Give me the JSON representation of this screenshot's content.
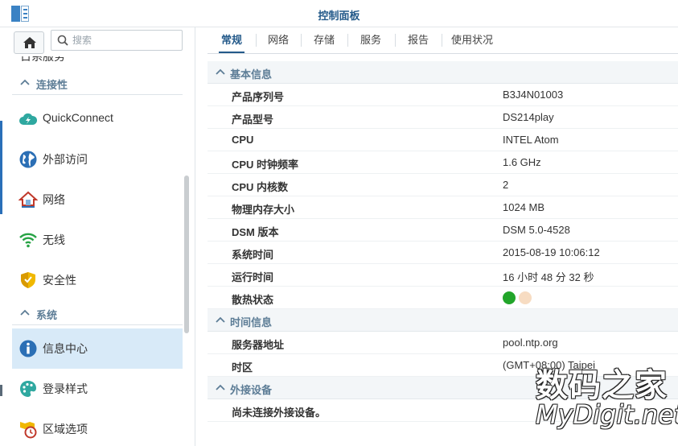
{
  "window": {
    "title": "控制面板"
  },
  "sidebar": {
    "search_placeholder": "搜索",
    "cut_item": "日系服务",
    "sections": [
      {
        "label": "连接性"
      },
      {
        "label": "系统"
      }
    ],
    "items": [
      {
        "label": "QuickConnect",
        "icon": "quickconnect-cloud-icon"
      },
      {
        "label": "外部访问",
        "icon": "globe-icon"
      },
      {
        "label": "网络",
        "icon": "house-network-icon"
      },
      {
        "label": "无线",
        "icon": "wifi-icon"
      },
      {
        "label": "安全性",
        "icon": "shield-icon"
      },
      {
        "label": "信息中心",
        "icon": "info-icon",
        "active": true
      },
      {
        "label": "登录样式",
        "icon": "palette-icon"
      },
      {
        "label": "区域选项",
        "icon": "clock-map-icon"
      }
    ]
  },
  "tabs": [
    {
      "label": "常规",
      "active": true
    },
    {
      "label": "网络"
    },
    {
      "label": "存储"
    },
    {
      "label": "服务"
    },
    {
      "label": "报告"
    },
    {
      "label": "使用状况"
    }
  ],
  "groups": {
    "basic": {
      "title": "基本信息",
      "rows": [
        {
          "key": "产品序列号",
          "value": "B3J4N01003"
        },
        {
          "key": "产品型号",
          "value": "DS214play"
        },
        {
          "key": "CPU",
          "value": "INTEL Atom"
        },
        {
          "key": "CPU 时钟频率",
          "value": "1.6 GHz"
        },
        {
          "key": "CPU 内核数",
          "value": "2"
        },
        {
          "key": "物理内存大小",
          "value": "1024 MB"
        },
        {
          "key": "DSM 版本",
          "value": "DSM 5.0-4528"
        },
        {
          "key": "系统时间",
          "value": "2015-08-19 10:06:12"
        },
        {
          "key": "运行时间",
          "value": "16 小时 48 分 32 秒"
        },
        {
          "key": "散热状态"
        }
      ]
    },
    "time": {
      "title": "时间信息",
      "rows": [
        {
          "key": "服务器地址",
          "value": "pool.ntp.org"
        },
        {
          "key": "时区",
          "value": "(GMT+08:00) Taipei"
        }
      ]
    },
    "external": {
      "title": "外接设备",
      "rows": [
        {
          "key": "尚未连接外接设备。"
        }
      ]
    }
  },
  "thermal_colors": {
    "ok": "#22a52a",
    "inactive": "#f7dcc2"
  },
  "watermark": {
    "line1": "数码之家",
    "line2": "MyDigit.net"
  }
}
